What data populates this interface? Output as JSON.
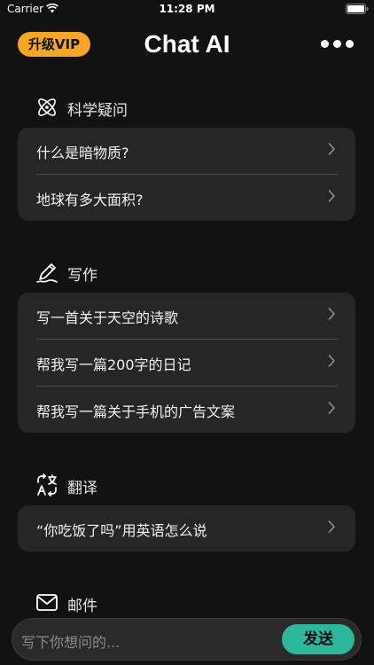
{
  "status_bar": {
    "carrier": "Carrier",
    "time": "11:28 PM"
  },
  "header": {
    "vip_label": "升级VIP",
    "title": "Chat AI",
    "more_icon": "more-horizontal-icon"
  },
  "sections": [
    {
      "title": "科学疑问",
      "icon": "atom-icon",
      "items": [
        {
          "label": "什么是暗物质?"
        },
        {
          "label": "地球有多大面积?"
        }
      ]
    },
    {
      "title": "写作",
      "icon": "pen-icon",
      "items": [
        {
          "label": "写一首关于天空的诗歌"
        },
        {
          "label": "帮我写一篇200字的日记"
        },
        {
          "label": "帮我写一篇关于手机的广告文案"
        }
      ]
    },
    {
      "title": "翻译",
      "icon": "translate-icon",
      "items": [
        {
          "label": "“你吃饭了吗”用英语怎么说"
        }
      ]
    },
    {
      "title": "邮件",
      "icon": "mail-icon",
      "items": []
    }
  ],
  "input": {
    "placeholder": "写下你想问的...",
    "send_label": "发送"
  },
  "colors": {
    "background": "#121212",
    "card": "#262626",
    "vip": "#f5a623",
    "send": "#2db89c"
  }
}
